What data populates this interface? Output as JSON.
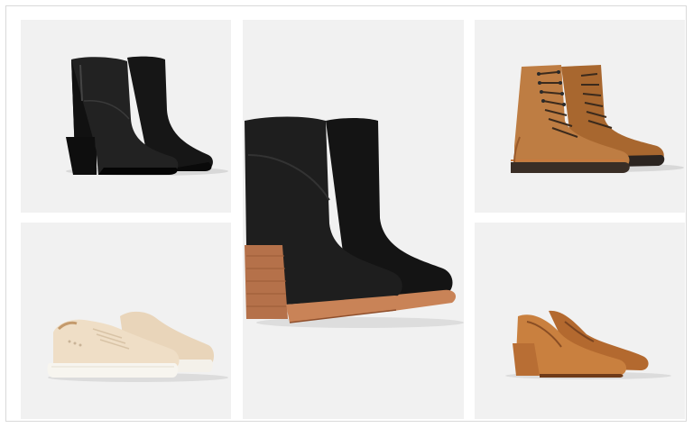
{
  "gallery": {
    "items": [
      {
        "icon": "black-ankle-boot-icon"
      },
      {
        "icon": "cream-sneaker-icon"
      },
      {
        "icon": "black-heeled-bootie-icon"
      },
      {
        "icon": "tan-lace-up-boot-icon"
      },
      {
        "icon": "cognac-block-heel-pump-icon"
      }
    ]
  },
  "colors": {
    "frame_border": "#d9d9d9",
    "tile_bg": "#f1f1f1",
    "black_leather": "#1c1c1c",
    "tan_leather": "#b9773f",
    "cream_suede": "#eedcc3",
    "cognac_leather": "#c0763c",
    "stacked_heel": "#b5714a"
  }
}
